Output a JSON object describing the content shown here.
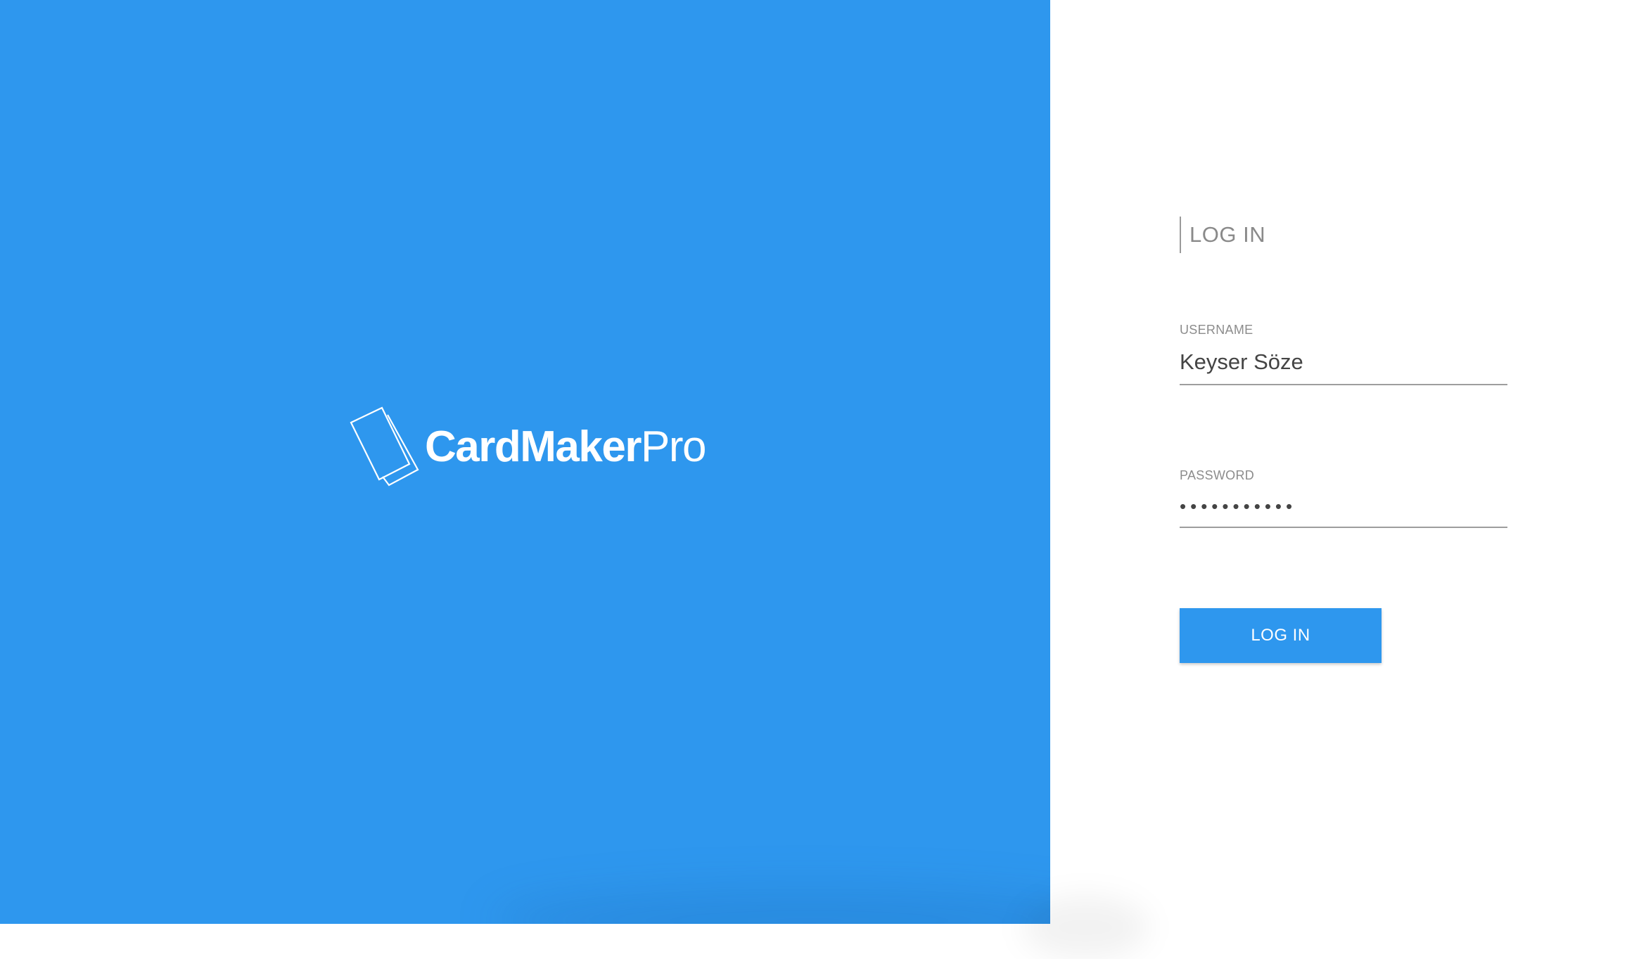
{
  "brand": {
    "name_bold": "CardMaker",
    "name_light": "Pro",
    "logo_icon": "cards-outline-icon",
    "panel_color": "#2e97ee"
  },
  "login_form": {
    "title": "LOG IN",
    "username": {
      "label": "USERNAME",
      "value": "Keyser Söze"
    },
    "password": {
      "label": "PASSWORD",
      "value": "•••••••••••"
    },
    "submit_label": "LOG IN",
    "accent_color": "#2e97ee"
  }
}
